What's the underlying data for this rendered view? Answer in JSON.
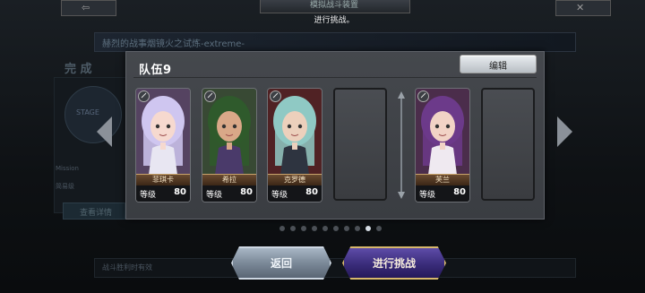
{
  "background": {
    "top_title": "模拟战斗装置",
    "subtitle": "进行挑战。",
    "stage_banner": "赫烈的战事烟镜火之试炼-extreme-",
    "complete_label": "完 成",
    "stage_label": "STAGE",
    "mission_label": "Mission",
    "mission_value": "简易级",
    "detail_button": "查看详情",
    "bottom_bar": "战斗胜利时有效"
  },
  "modal": {
    "team_title": "队伍9",
    "edit_button": "编辑",
    "level_label": "等级",
    "slots": [
      {
        "filled": true,
        "name": "菲琪卡",
        "level": "80",
        "palette": {
          "hair": "#cfc6f0",
          "skin": "#f6d9cf",
          "cloth": "#e8e6f2",
          "accent": "#c08ad9"
        }
      },
      {
        "filled": true,
        "name": "希拉",
        "level": "80",
        "palette": {
          "hair": "#2f5a2c",
          "skin": "#d9a888",
          "cloth": "#4a3a6a",
          "accent": "#6e9c5a"
        }
      },
      {
        "filled": true,
        "name": "克罗德",
        "level": "80",
        "palette": {
          "hair": "#8fc9c4",
          "skin": "#ecd0bc",
          "cloth": "#2e3440",
          "accent": "#b32c2c"
        }
      },
      {
        "filled": false
      },
      {
        "filled": true,
        "name": "芙兰",
        "level": "80",
        "palette": {
          "hair": "#6c3a8a",
          "skin": "#f2d3c6",
          "cloth": "#efe9f0",
          "accent": "#a44a9a"
        }
      },
      {
        "filled": false
      }
    ],
    "page_count": 10,
    "active_page": 9
  },
  "buttons": {
    "back": "返回",
    "start": "进行挑战"
  },
  "icons": {
    "back_arrow": "left-arrow-icon",
    "close": "close-icon",
    "weapon": "sword-icon",
    "swap": "swap-arrows-icon"
  }
}
